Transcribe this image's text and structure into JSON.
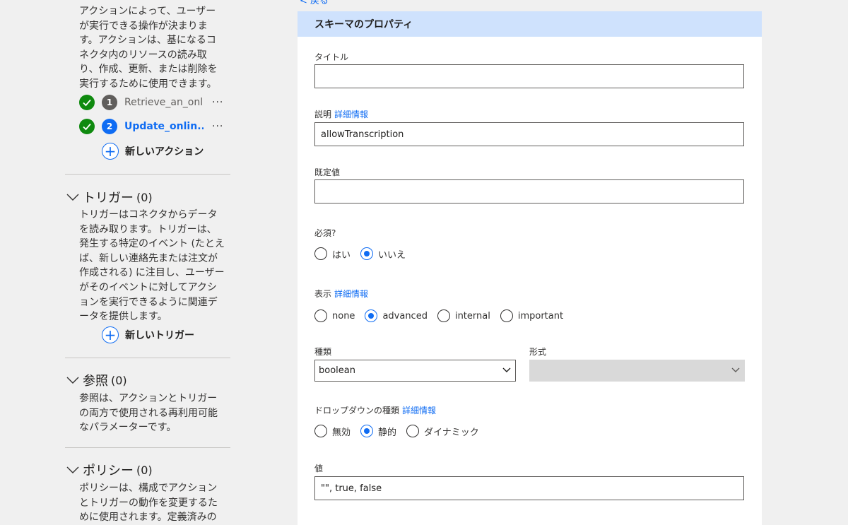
{
  "left": {
    "actions_desc": [
      "アクションによって、ユーザー",
      "が実行できる操作が決まりま",
      "す。アクションは、基になるコ",
      "ネクタ内のリソースの読み取",
      "り、作成、更新、または削除を",
      "実行するために使用できます。"
    ],
    "actions": [
      {
        "num": "1",
        "name": "Retrieve_an_onl...",
        "more": "···"
      },
      {
        "num": "2",
        "name": "Update_onlin...",
        "more": "···"
      }
    ],
    "new_action": "新しいアクション",
    "triggers": {
      "title": "トリガー",
      "count": "(0)",
      "desc": [
        "トリガーはコネクタからデータ",
        "を読み取ります。トリガーは、",
        "発生する特定のイベント (たとえ",
        "ば、新しい連絡先または注文が",
        "作成される) に注目し、ユーザー",
        "がそのイベントに対してアクシ",
        "ョンを実行できるように関連デ",
        "ータを提供します。"
      ],
      "new_label": "新しいトリガー"
    },
    "references": {
      "title": "参照",
      "count": "(0)",
      "desc": [
        "参照は、アクションとトリガー",
        "の両方で使用される再利用可能",
        "なパラメーターです。"
      ]
    },
    "policies": {
      "title": "ポリシー",
      "count": "(0)",
      "desc": [
        "ポリシーは、構成でアクション",
        "とトリガーの動作を変更するた",
        "めに使用されます。定義済みの"
      ]
    }
  },
  "back_label": "< 戻る",
  "panel": {
    "header": "スキーマのプロパティ",
    "title_label": "タイトル",
    "title_value": "",
    "description_label": "説明",
    "description_link": "詳細情報",
    "description_value": "allowTranscription",
    "default_label": "既定値",
    "default_value": "",
    "required_label": "必須?",
    "required_options": [
      "はい",
      "いいえ"
    ],
    "required_selected": "いいえ",
    "visibility_label": "表示",
    "visibility_link": "詳細情報",
    "visibility_options": [
      "none",
      "advanced",
      "internal",
      "important"
    ],
    "visibility_selected": "advanced",
    "type_label": "種類",
    "type_value": "boolean",
    "format_label": "形式",
    "format_value": "",
    "dropdown_label": "ドロップダウンの種類",
    "dropdown_link": "詳細情報",
    "dropdown_options": [
      "無効",
      "静的",
      "ダイナミック"
    ],
    "dropdown_selected": "静的",
    "values_label": "値",
    "values_value": "\"\", true, false"
  },
  "colors": {
    "accent": "#0f6cf3",
    "success": "#0f8a0f",
    "header_bg": "#cfe2fd"
  }
}
